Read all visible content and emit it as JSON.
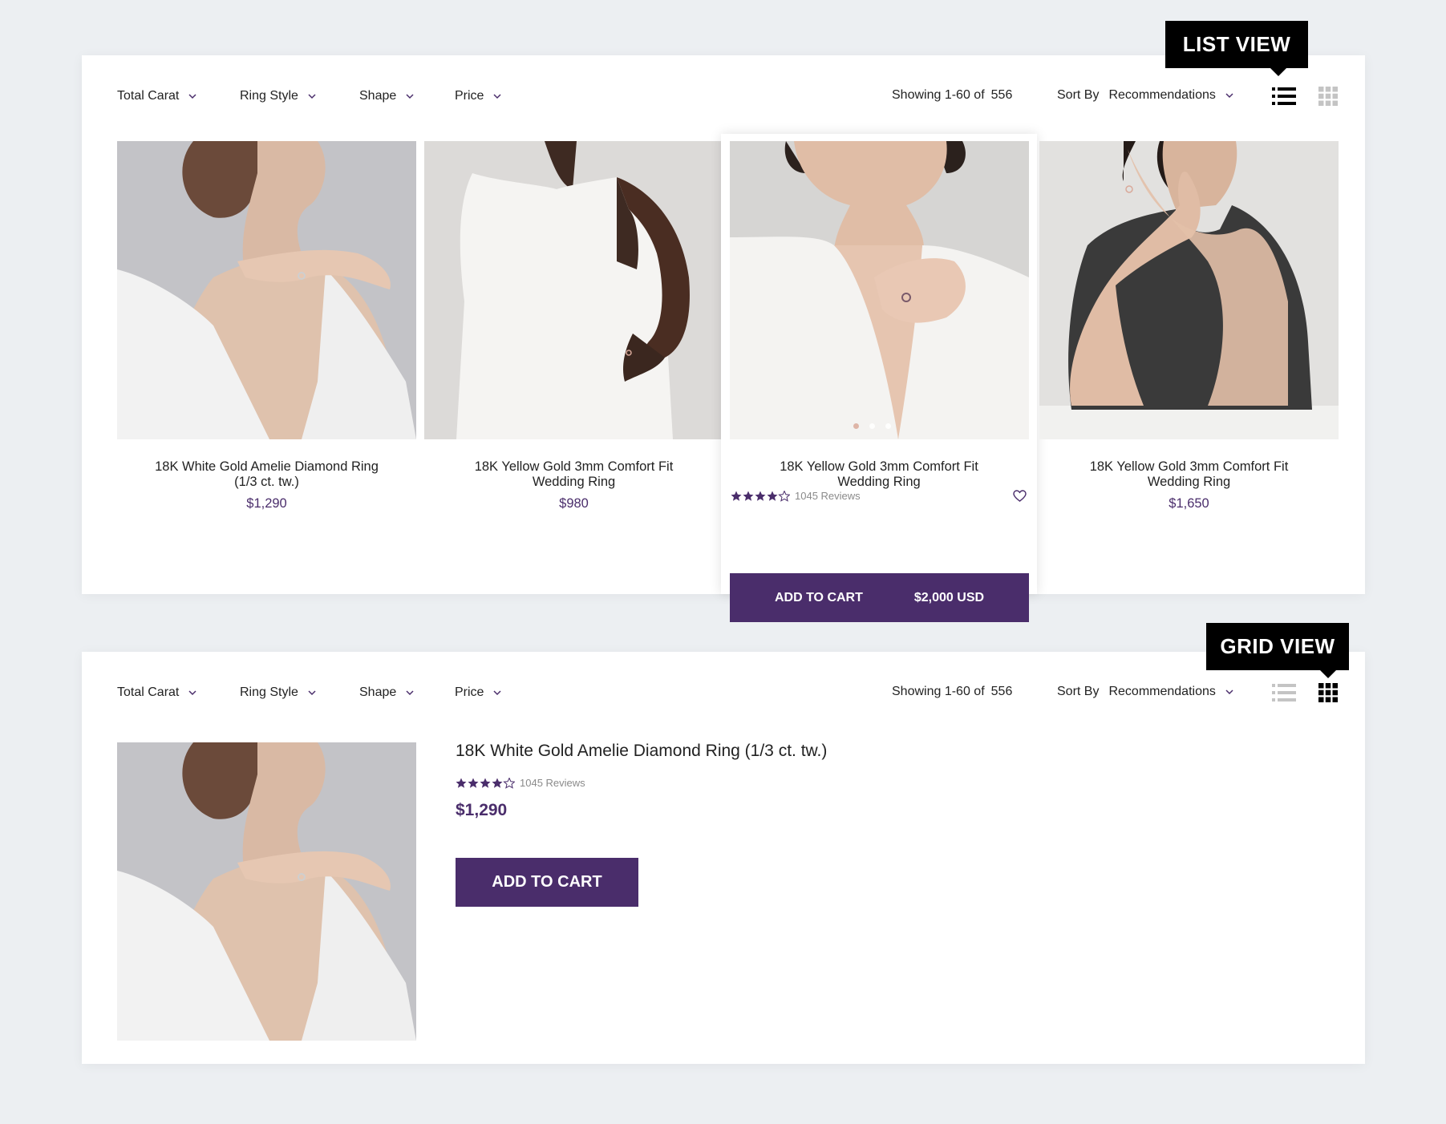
{
  "filters": [
    {
      "label": "Total Carat"
    },
    {
      "label": "Ring Style"
    },
    {
      "label": "Shape"
    },
    {
      "label": "Price"
    }
  ],
  "results": {
    "showing": "Showing 1-60 of",
    "total": "556"
  },
  "sort": {
    "label": "Sort By",
    "value": "Recommendations"
  },
  "tooltips": {
    "list_view": "LIST VIEW",
    "grid_view": "GRID VIEW"
  },
  "products": [
    {
      "name_line1": "18K White Gold Amelie Diamond Ring",
      "name_line2": "(1/3 ct. tw.)",
      "price": "$1,290"
    },
    {
      "name_line1": "18K Yellow Gold 3mm Comfort Fit",
      "name_line2": "Wedding Ring",
      "price": "$980"
    },
    {
      "name_line1": "18K Yellow Gold 3mm Comfort Fit",
      "name_line2": "Wedding Ring",
      "reviews": "1045 Reviews",
      "rating": 4,
      "cart_label": "ADD TO CART",
      "cart_price": "$2,000 USD"
    },
    {
      "name_line1": "18K Yellow Gold 3mm Comfort Fit",
      "name_line2": "Wedding Ring",
      "price": "$1,650"
    }
  ],
  "detail": {
    "name": "18K White Gold Amelie Diamond Ring (1/3 ct. tw.)",
    "rating": 4,
    "reviews": "1045 Reviews",
    "price": "$1,290",
    "cart_label": "ADD TO CART"
  },
  "colors": {
    "accent": "#4a2d6b",
    "tooltip_bg": "#000000",
    "page_bg": "#eceff2"
  }
}
